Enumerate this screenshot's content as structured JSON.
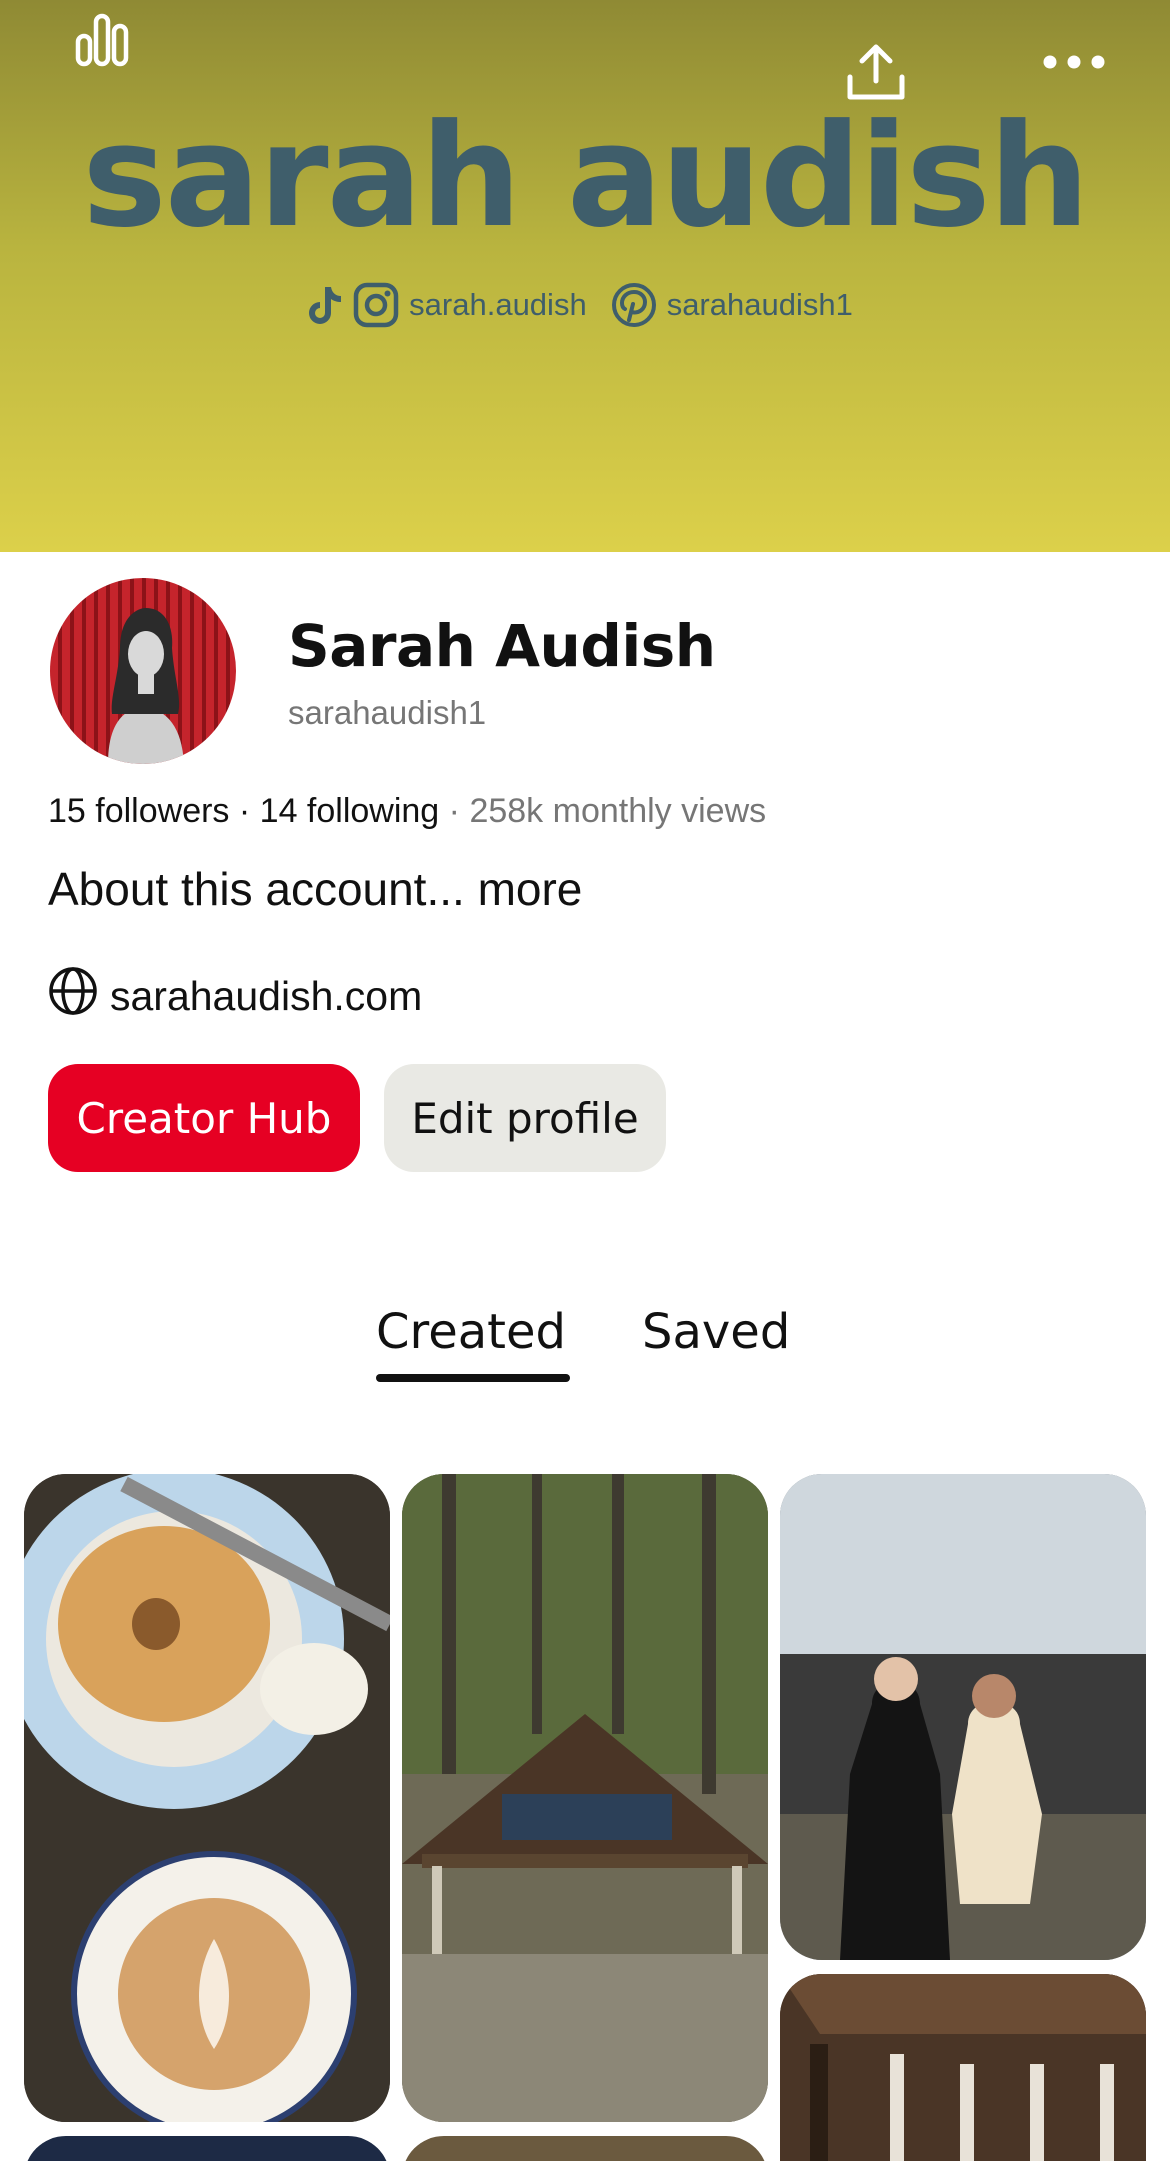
{
  "cover": {
    "title": "sarah audish",
    "instagram_handle": "sarah.audish",
    "pinterest_handle": "sarahaudish1",
    "gradient_top": "#8f8a34",
    "gradient_bottom": "#dcd04a",
    "title_color": "#3f5e6b"
  },
  "profile": {
    "name": "Sarah Audish",
    "username": "sarahaudish1",
    "followers": "15 followers",
    "following": "14 following",
    "monthly_views": "258k monthly views",
    "about": "About this account... more",
    "website": "sarahaudish.com"
  },
  "buttons": {
    "creator_hub": "Creator Hub",
    "edit_profile": "Edit profile",
    "primary_color": "#e60023"
  },
  "tabs": [
    {
      "label": "Created",
      "active": true
    },
    {
      "label": "Saved",
      "active": false
    }
  ],
  "icons": {
    "top_left": "analytics-icon",
    "top_share": "share-icon",
    "top_more": "more-options-icon",
    "social": [
      "tiktok-icon",
      "instagram-icon",
      "pinterest-icon"
    ],
    "website": "globe-icon"
  },
  "pins": [
    "bagel-coffee-photo",
    "forest-trail-shelter-photo",
    "friends-event-photo",
    "wooden-bridge-photo",
    "pin-photo",
    "pin-photo"
  ]
}
